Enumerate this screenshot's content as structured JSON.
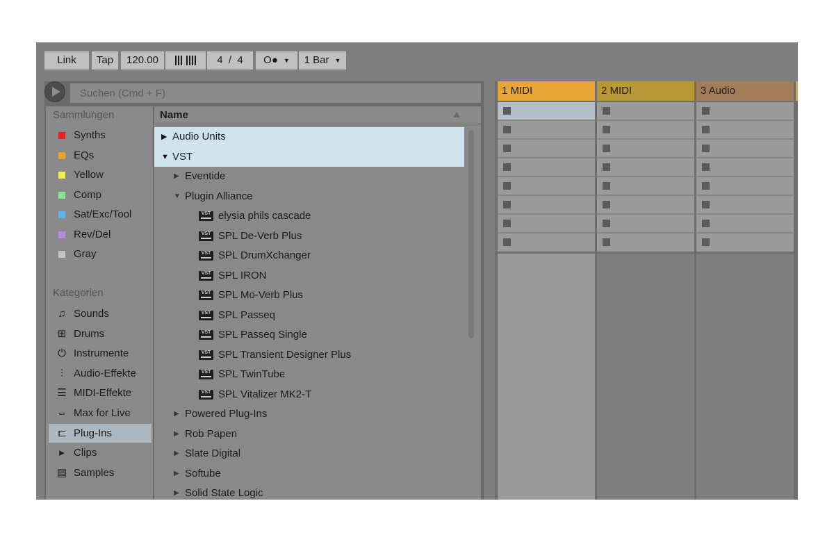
{
  "toolbar": {
    "link": "Link",
    "tap": "Tap",
    "tempo": "120.00",
    "time_sig_num": "4",
    "time_sig_sep": "/",
    "time_sig_den": "4",
    "metronome": "O●",
    "quantization": "1 Bar"
  },
  "browser": {
    "search_placeholder": "Suchen (Cmd + F)",
    "collections_header": "Sammlungen",
    "collections": [
      {
        "label": "Synths",
        "color": "#e8221d"
      },
      {
        "label": "EQs",
        "color": "#f0a028"
      },
      {
        "label": "Yellow",
        "color": "#f3ee4a"
      },
      {
        "label": "Comp",
        "color": "#86e58f"
      },
      {
        "label": "Sat/Exc/Tool",
        "color": "#5bb4ea"
      },
      {
        "label": "Rev/Del",
        "color": "#b48ae4"
      },
      {
        "label": "Gray",
        "color": "#c4c4c4"
      }
    ],
    "categories_header": "Kategorien",
    "categories": [
      {
        "label": "Sounds",
        "icon": "note-icon"
      },
      {
        "label": "Drums",
        "icon": "grid-icon"
      },
      {
        "label": "Instrumente",
        "icon": "power-icon"
      },
      {
        "label": "Audio-Effekte",
        "icon": "waveform-icon"
      },
      {
        "label": "MIDI-Effekte",
        "icon": "midi-icon"
      },
      {
        "label": "Max for Live",
        "icon": "max-icon"
      },
      {
        "label": "Plug-Ins",
        "icon": "plug-icon",
        "selected": true
      },
      {
        "label": "Clips",
        "icon": "clip-icon"
      },
      {
        "label": "Samples",
        "icon": "sample-icon"
      }
    ],
    "column_header": "Name",
    "rows": [
      {
        "label": "Audio Units",
        "arrow": "▶",
        "level": 0,
        "highlight": true
      },
      {
        "label": "VST",
        "arrow": "▼",
        "level": 0,
        "highlight": true
      },
      {
        "label": "Eventide",
        "arrow": "▶",
        "level": 1
      },
      {
        "label": "Plugin Alliance",
        "arrow": "▼",
        "level": 1
      },
      {
        "label": "elysia phils cascade",
        "level": 2,
        "vst": true
      },
      {
        "label": "SPL De-Verb Plus",
        "level": 2,
        "vst": true
      },
      {
        "label": "SPL DrumXchanger",
        "level": 2,
        "vst": true
      },
      {
        "label": "SPL IRON",
        "level": 2,
        "vst": true
      },
      {
        "label": "SPL Mo-Verb Plus",
        "level": 2,
        "vst": true
      },
      {
        "label": "SPL Passeq",
        "level": 2,
        "vst": true
      },
      {
        "label": "SPL Passeq Single",
        "level": 2,
        "vst": true
      },
      {
        "label": "SPL Transient Designer Plus",
        "level": 2,
        "vst": true
      },
      {
        "label": "SPL TwinTube",
        "level": 2,
        "vst": true
      },
      {
        "label": "SPL Vitalizer MK2-T",
        "level": 2,
        "vst": true
      },
      {
        "label": "Powered Plug-Ins",
        "arrow": "▶",
        "level": 1
      },
      {
        "label": "Rob Papen",
        "arrow": "▶",
        "level": 1
      },
      {
        "label": "Slate Digital",
        "arrow": "▶",
        "level": 1
      },
      {
        "label": "Softube",
        "arrow": "▶",
        "level": 1
      },
      {
        "label": "Solid State Logic",
        "arrow": "▶",
        "level": 1
      }
    ],
    "vst_badge": "VST"
  },
  "session": {
    "tracks": [
      {
        "label": "1 MIDI",
        "color": "#e8a535",
        "body": "#9b9b9b"
      },
      {
        "label": "2 MIDI",
        "color": "#b89735",
        "body": "#7f7f7f"
      },
      {
        "label": "3 Audio",
        "color": "#a37c58",
        "body": "#7f7f7f"
      }
    ],
    "slot_count": 8
  }
}
